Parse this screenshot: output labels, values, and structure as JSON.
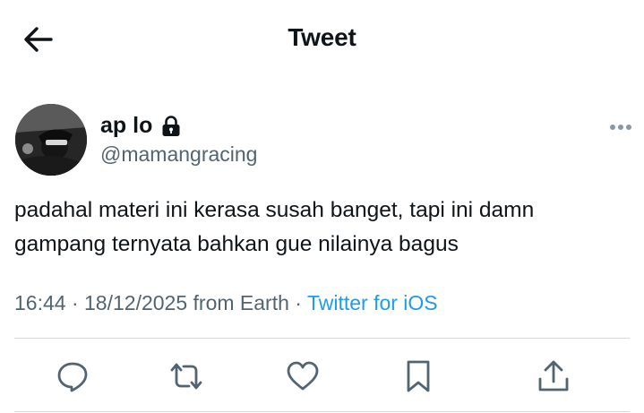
{
  "header": {
    "title": "Tweet",
    "back_icon": "arrow-left-icon"
  },
  "author": {
    "display_name": "ap lo",
    "handle": "@mamangracing",
    "protected_icon": "lock-icon",
    "more_icon": "more-horizontal-icon"
  },
  "tweet": {
    "text_line_1": "padahal materi ini kerasa susah banget, tapi ini damn",
    "text_line_2": "gampang ternyata bahkan gue nilainya bagus",
    "time": "16:44",
    "date": "18/12/2025",
    "location": "from Earth",
    "separator": "·",
    "source": "Twitter for iOS"
  },
  "actions": {
    "icons": [
      "reply-icon",
      "retweet-icon",
      "like-icon",
      "bookmark-icon",
      "share-icon"
    ]
  },
  "colors": {
    "text_primary": "#0f1419",
    "text_secondary": "#536471",
    "accent": "#1d9bf0",
    "divider": "#cfd9de"
  }
}
